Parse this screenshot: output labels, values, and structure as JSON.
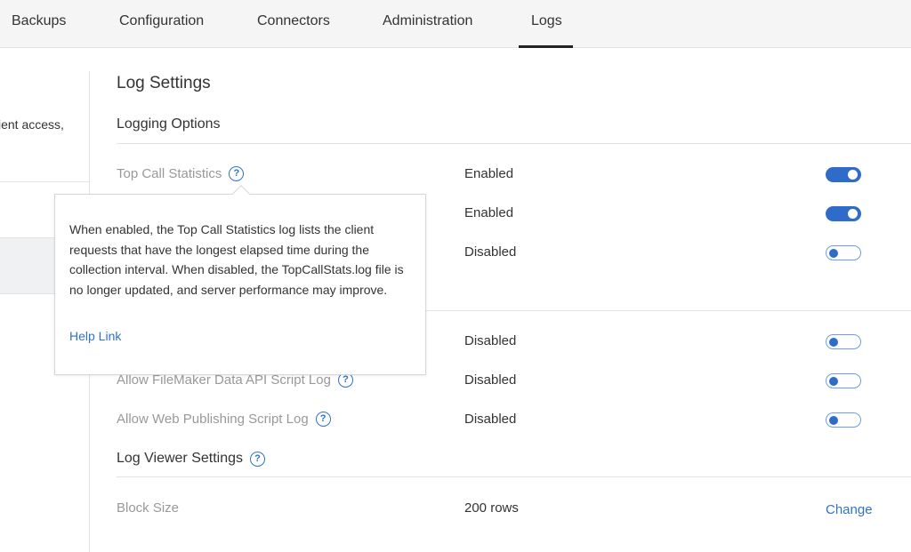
{
  "tabs": [
    {
      "label": "Backups",
      "active": false
    },
    {
      "label": "Configuration",
      "active": false
    },
    {
      "label": "Connectors",
      "active": false
    },
    {
      "label": "Administration",
      "active": false
    },
    {
      "label": "Logs",
      "active": true
    }
  ],
  "left_panel": {
    "truncated_text": "ient access,"
  },
  "main": {
    "title": "Log Settings",
    "logging_options": {
      "title": "Logging Options",
      "rows": [
        {
          "label": "Top Call Statistics",
          "value": "Enabled",
          "toggle_on": true
        },
        {
          "label": "",
          "value": "Enabled",
          "toggle_on": true
        },
        {
          "label": "",
          "value": "Disabled",
          "toggle_on": false
        }
      ]
    },
    "script_logs": {
      "rows": [
        {
          "label": "",
          "value": "Disabled",
          "toggle_on": false
        },
        {
          "label": "Allow FileMaker Data API Script Log",
          "value": "Disabled",
          "toggle_on": false
        },
        {
          "label": "Allow Web Publishing Script Log",
          "value": "Disabled",
          "toggle_on": false
        }
      ]
    },
    "log_viewer": {
      "title": "Log Viewer Settings",
      "block_size_label": "Block Size",
      "block_size_value": "200 rows",
      "change_label": "Change"
    }
  },
  "tooltip": {
    "text": "When enabled, the Top Call Statistics log lists the client requests that have the longest elapsed time during the collection interval. When disabled, the TopCallStats.log file is no longer updated, and server performance may improve.",
    "link_label": "Help Link"
  },
  "icons": {
    "help": "?"
  },
  "colors": {
    "accent": "#2f6bc9",
    "link": "#2f73c9",
    "tabbar_bg": "#f5f5f5"
  }
}
